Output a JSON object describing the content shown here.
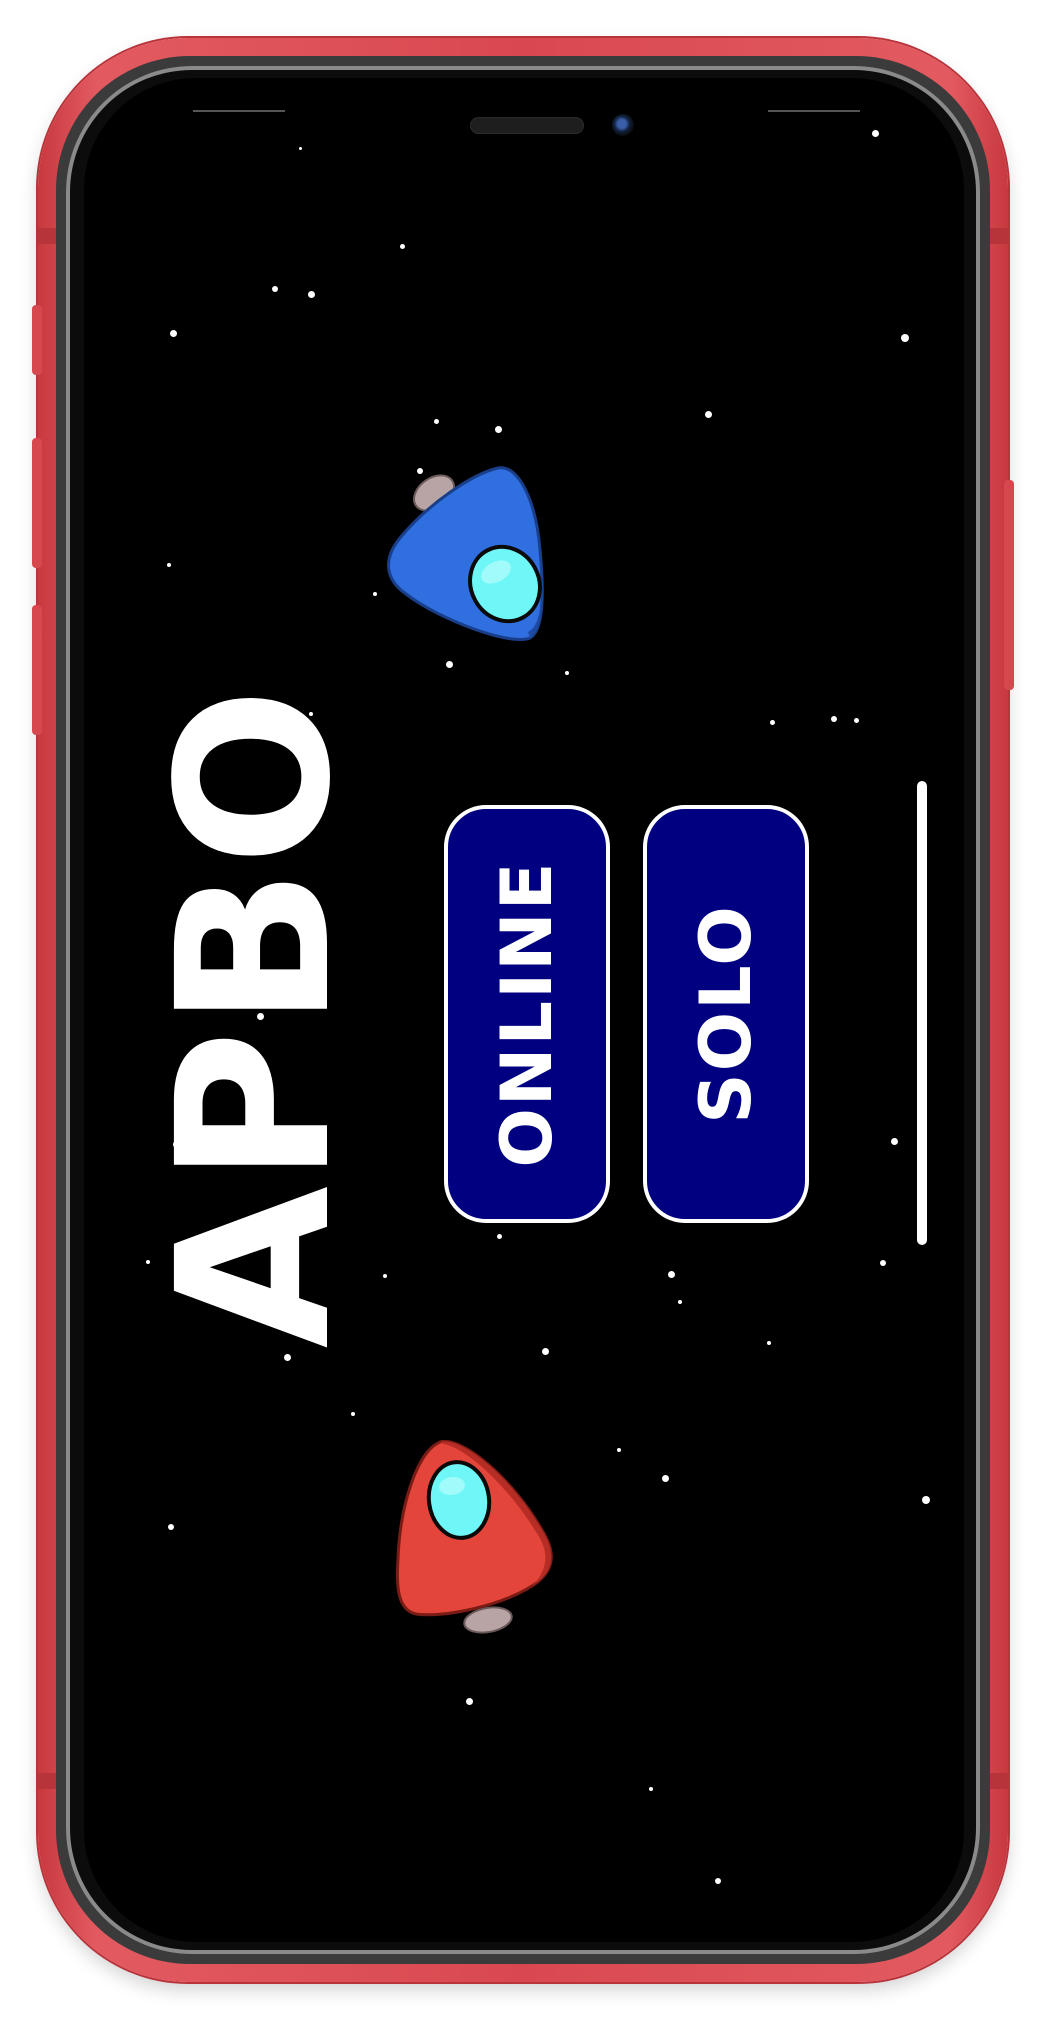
{
  "app": {
    "title": "APBO"
  },
  "menu": {
    "online_label": "ONLINE",
    "solo_label": "SOLO"
  },
  "colors": {
    "background": "#000000",
    "button_fill": "#000080",
    "button_border": "#ffffff",
    "title_text": "#ffffff",
    "ship_player_one": "#2f6fe0",
    "ship_player_two": "#e4453a",
    "cockpit": "#6ff7f7",
    "phone_frame": "#d94850"
  },
  "icons": {
    "ship_top": "blue-spaceship-icon",
    "ship_bottom": "red-spaceship-icon"
  }
}
